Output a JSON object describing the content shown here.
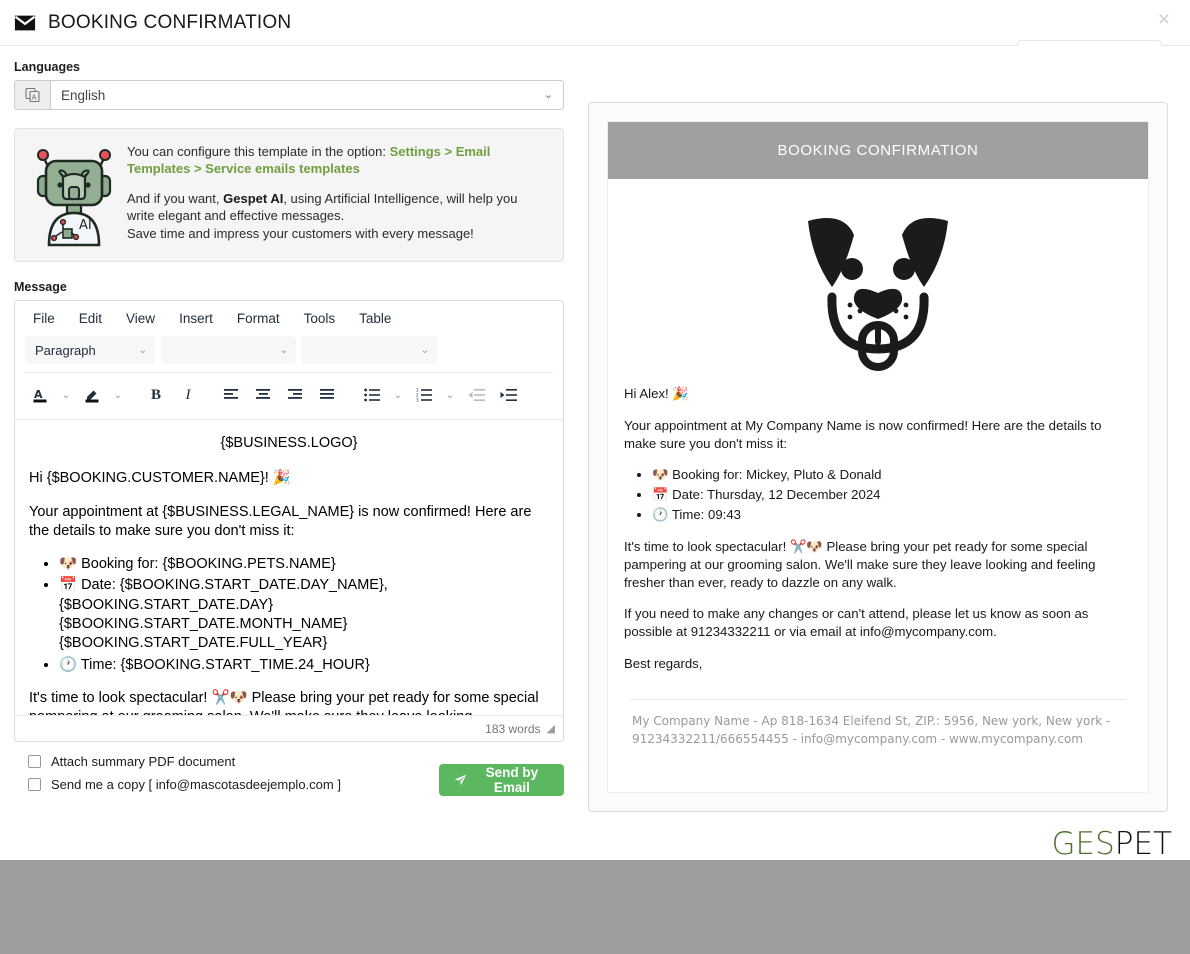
{
  "header": {
    "title": "BOOKING CONFIRMATION",
    "close_label": "×",
    "mail_icon": "envelope-icon"
  },
  "languages": {
    "label": "Languages",
    "selected": "English",
    "addon_icon": "translate-icon",
    "chevron": "⌄"
  },
  "info_card": {
    "icon": "ai-robot-icon",
    "line1_prefix": "You can configure this template in the option: ",
    "line1_link": "Settings > Email Templates > Service emails templates",
    "line2_prefix": "And if you want, ",
    "line2_brand": "Gespet AI",
    "line2_suffix": ", using Artificial Intelligence, will help you write elegant and effective messages.",
    "line3": "Save time and impress your customers with every message!",
    "link_color": "#6f9f3f"
  },
  "message": {
    "label": "Message",
    "menubar": [
      "File",
      "Edit",
      "View",
      "Insert",
      "Format",
      "Tools",
      "Table"
    ],
    "format_select": "Paragraph",
    "font_select": "",
    "size_select": "",
    "toolbar_icons": [
      "text-color-icon",
      "text-color-chevron-icon",
      "highlight-color-icon",
      "highlight-color-chevron-icon",
      "bold-icon",
      "italic-icon",
      "align-left-icon",
      "align-center-icon",
      "align-right-icon",
      "align-justify-icon",
      "bullet-list-icon",
      "bullet-list-chevron-icon",
      "numbered-list-icon",
      "numbered-list-chevron-icon",
      "outdent-icon",
      "indent-icon"
    ],
    "word_count": "183 words",
    "resize_handle": "resize-grip-icon",
    "content": {
      "logo_placeholder": "{$BUSINESS.LOGO}",
      "greeting": "Hi {$BOOKING.CUSTOMER.NAME}! 🎉",
      "intro": "Your appointment at {$BUSINESS.LEGAL_NAME} is now confirmed! Here are the details to make sure you don't miss it:",
      "bullets": [
        "🐶 Booking for: {$BOOKING.PETS.NAME}",
        "📅 Date: {$BOOKING.START_DATE.DAY_NAME}, {$BOOKING.START_DATE.DAY} {$BOOKING.START_DATE.MONTH_NAME} {$BOOKING.START_DATE.FULL_YEAR}",
        "🕐 Time: {$BOOKING.START_TIME.24_HOUR}"
      ],
      "paragraph": "It's time to look spectacular! ✂️🐶 Please bring your pet ready for some special pampering at our grooming salon. We'll make sure they leave looking"
    }
  },
  "options": {
    "attach_pdf": "Attach summary PDF document",
    "send_copy": "Send me a copy [ info@mascotasdeejemplo.com ]",
    "send_button": "Send by Email",
    "send_icon": "paper-plane-icon",
    "send_button_color": "#5cb860"
  },
  "preview": {
    "banner_title": "BOOKING CONFIRMATION",
    "banner_color": "#a0a0a3",
    "logo_icon": "dog-face-logo-icon",
    "greeting": "Hi Alex! 🎉",
    "intro": "Your appointment at My Company Name is now confirmed! Here are the details to make sure you don't miss it:",
    "bullets": [
      "🐶 Booking for: Mickey, Pluto & Donald",
      "📅 Date: Thursday, 12 December 2024",
      "🕐 Time: 09:43"
    ],
    "paragraph1": "It's time to look spectacular! ✂️🐶 Please bring your pet ready for some special pampering at our grooming salon. We'll make sure they leave looking and feeling fresher than ever, ready to dazzle on any walk.",
    "paragraph2": "If you need to make any changes or can't attend, please let us know as soon as possible at 91234332211 or via email at info@mycompany.com.",
    "signoff": "Best regards,",
    "footer": "My Company Name - Ap 818-1634 Eleifend St, ZIP.: 5956, New york, New york - 91234332211/666554455 - info@mycompany.com - www.mycompany.com"
  },
  "brand": {
    "logo_part1": "GES",
    "logo_part2": "PET",
    "color1": "#4f6f2c",
    "color2": "#111111"
  }
}
